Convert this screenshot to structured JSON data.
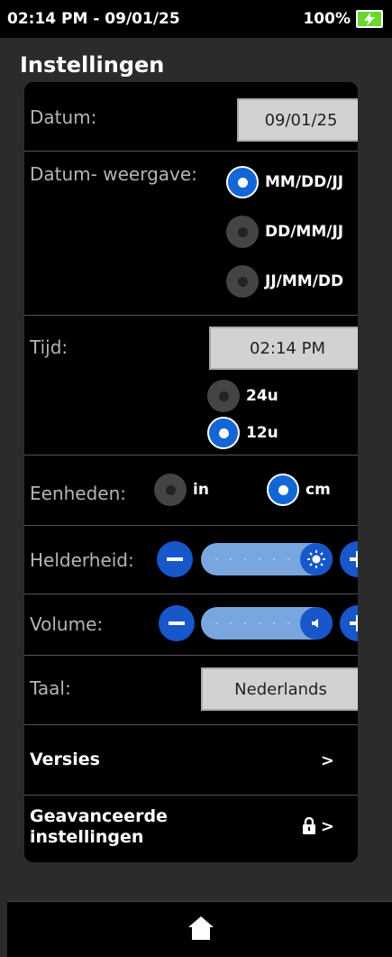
{
  "status": {
    "datetime": "02:14 PM - 09/01/25",
    "battery": "100%"
  },
  "page_title": "Instellingen",
  "date": {
    "label": "Datum:",
    "value": "09/01/25"
  },
  "date_format": {
    "label": "Datum- weergave:",
    "options": [
      "MM/DD/JJ",
      "DD/MM/JJ",
      "JJ/MM/DD"
    ],
    "selected": "MM/DD/JJ"
  },
  "time": {
    "label": "Tijd:",
    "value": "02:14 PM",
    "options": [
      "24u",
      "12u"
    ],
    "selected": "12u"
  },
  "units": {
    "label": "Eenheden:",
    "options": [
      "in",
      "cm"
    ],
    "selected": "cm"
  },
  "brightness": {
    "label": "Helderheid:",
    "level": 1.0
  },
  "volume": {
    "label": "Volume:",
    "level": 1.0
  },
  "language": {
    "label": "Taal:",
    "value": "Nederlands"
  },
  "versions": {
    "label": "Versies",
    "chevron": ">"
  },
  "advanced": {
    "label_line1": "Geavanceerde",
    "label_line2": "instellingen",
    "chevron": ">"
  },
  "icons": {
    "home": "home-icon",
    "lock": "lock-icon",
    "sun": "sun-icon",
    "speaker": "speaker-icon"
  },
  "colors": {
    "accent": "#1757c9",
    "slider_track": "#7aa6e0",
    "battery": "#6bd62e"
  }
}
